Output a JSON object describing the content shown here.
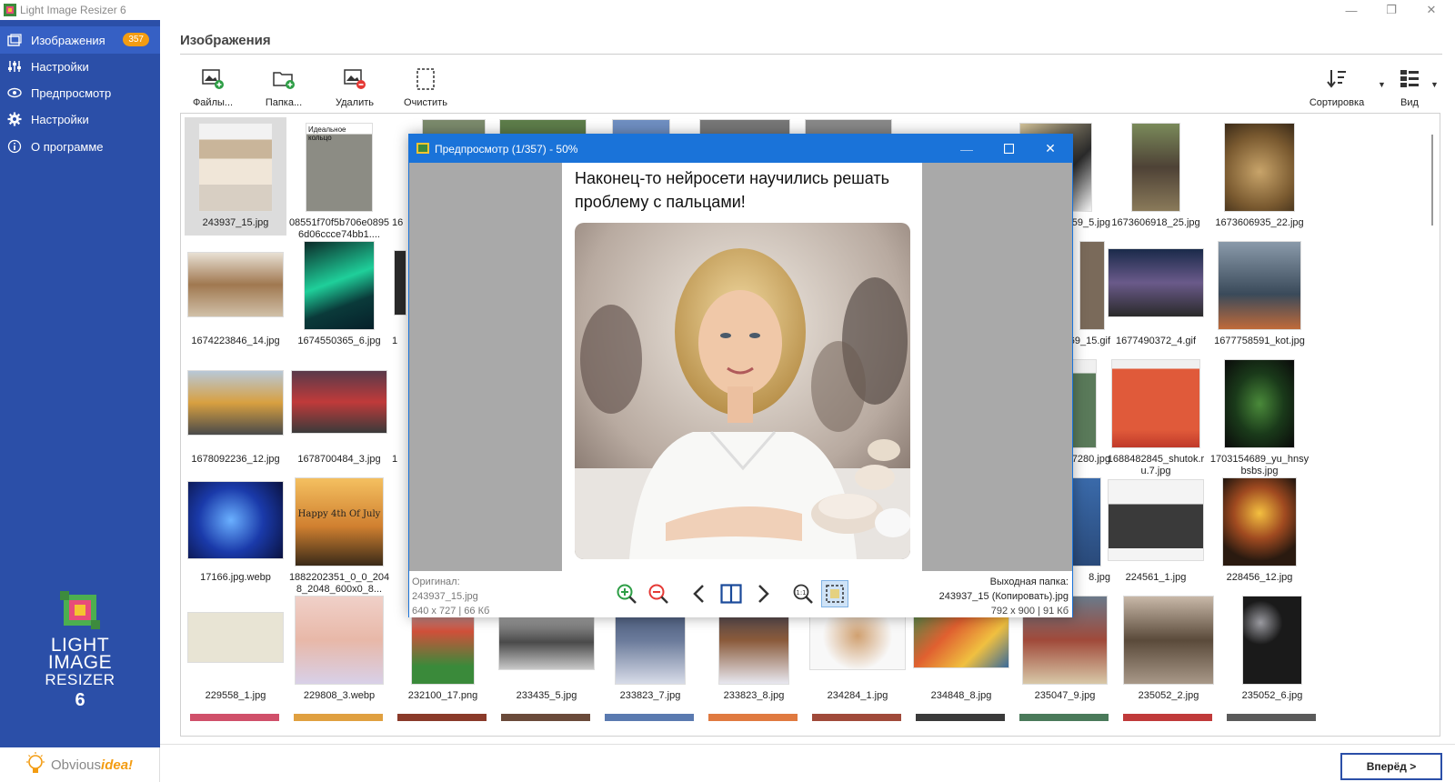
{
  "window": {
    "title": "Light Image Resizer 6",
    "minimize": "—",
    "restore": "❐",
    "close": "✕"
  },
  "sidebar": {
    "items": [
      {
        "label": "Изображения",
        "icon": "images-icon",
        "badge": "357"
      },
      {
        "label": "Настройки",
        "icon": "sliders-icon"
      },
      {
        "label": "Предпросмотр",
        "icon": "eye-icon"
      },
      {
        "label": "Настройки",
        "icon": "gear-icon"
      },
      {
        "label": "О программе",
        "icon": "info-icon"
      }
    ],
    "logo": {
      "line1": "LIGHT",
      "line2": "IMAGE",
      "line3": "RESIZER",
      "version": "6"
    },
    "brand": {
      "prefix": "Obvious",
      "suffix": "idea!"
    }
  },
  "main": {
    "title": "Изображения",
    "toolbar": {
      "files": "Файлы...",
      "folder": "Папка...",
      "remove": "Удалить",
      "clear": "Очистить",
      "sort": "Сортировка",
      "view": "Вид"
    }
  },
  "grid": {
    "row1": [
      "243937_15.jpg",
      "08551f70f5b706e08956d06ccce74bb1....",
      "16",
      "",
      "",
      "",
      "",
      "",
      "59_5.jpg",
      "1673606918_25.jpg",
      "1673606935_22.jpg"
    ],
    "row2": [
      "1674223846_14.jpg",
      "1674550365_6.jpg",
      "1",
      "69_15.gif",
      "1677490372_4.gif",
      "1677758591_kot.jpg"
    ],
    "row3": [
      "1678092236_12.jpg",
      "1678700484_3.jpg",
      "1",
      "29_shutok.17280.jpg",
      "1688482845_shutok.ru.7.jpg",
      "1703154689_yu_hnsybsbs.jpg"
    ],
    "row4": [
      "17166.jpg.webp",
      "1882202351_0_0_2048_2048_600x0_8...",
      "8.jpg",
      "224561_1.jpg",
      "228456_12.jpg"
    ],
    "row5": [
      "229558_1.jpg",
      "229808_3.webp",
      "232100_17.png",
      "233435_5.jpg",
      "233823_7.jpg",
      "233823_8.jpg",
      "234284_1.jpg",
      "234848_8.jpg",
      "235047_9.jpg",
      "235052_2.jpg",
      "235052_6.jpg"
    ],
    "thumb_texts": {
      "ring": "Идеальное кольцо",
      "happy": "Happy 4th Of July"
    }
  },
  "preview": {
    "title": "Предпросмотр (1/357) - 50%",
    "caption": "Наконец-то нейросети научились решать проблему с пальцами!",
    "original_label": "Оригинал:",
    "original_name": "243937_15.jpg",
    "original_dims": "640 x 727  |  66 Кб",
    "output_label": "Выходная папка:",
    "output_name": "243937_15 (Копировать).jpg",
    "output_dims": "792 x 900  |  91 Кб"
  },
  "footer": {
    "next": "Вперёд >"
  },
  "colors": {
    "sidebar": "#2b4fa8",
    "accent": "#1a73d9",
    "badge": "#f39c12"
  }
}
